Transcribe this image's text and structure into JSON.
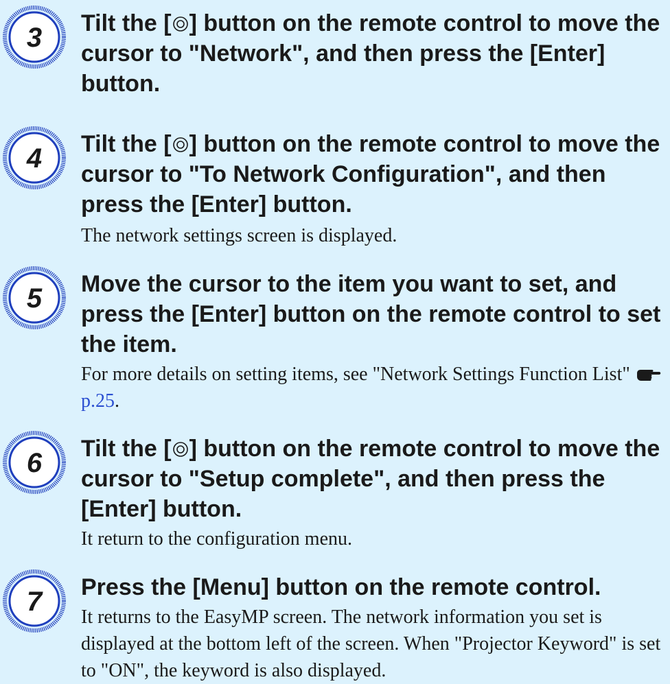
{
  "colors": {
    "page_background": "#dcf2fd",
    "badge_ring": "#1f3fbd",
    "badge_fill": "#ffffff",
    "text": "#1a1a1a",
    "link": "#2b4fd1"
  },
  "icons": {
    "step_badge": "numbered-circle-icon",
    "cursor_button": "concentric-circle-icon",
    "reference": "pointing-hand-icon"
  },
  "steps": [
    {
      "number": "3",
      "heading_pre": "Tilt the [",
      "heading_post": "] button on the remote control to move the cursor to \"Network\", and then press the [Enter] button."
    },
    {
      "number": "4",
      "heading_pre": "Tilt the [",
      "heading_post": "] button on the remote control to move the cursor to \"To Network Configuration\", and then press the [Enter] button.",
      "body": "The network settings screen is displayed."
    },
    {
      "number": "5",
      "heading": "Move the cursor to the item you want to set, and press the [Enter] button on the remote control to set the item.",
      "body_pre": "For more details on setting items, see \"Network Settings Function List\"",
      "link_text": "p.25",
      "body_post": "."
    },
    {
      "number": "6",
      "heading_pre": "Tilt the [",
      "heading_post": "] button on the remote control to move the cursor to \"Setup complete\", and then press the [Enter] button.",
      "body": "It return to the configuration menu."
    },
    {
      "number": "7",
      "heading": "Press the [Menu] button on the remote control.",
      "body": "It returns to the EasyMP screen. The network information you set is displayed at the bottom left of the screen. When \"Projector Keyword\" is set to \"ON\", the keyword is also displayed."
    }
  ]
}
